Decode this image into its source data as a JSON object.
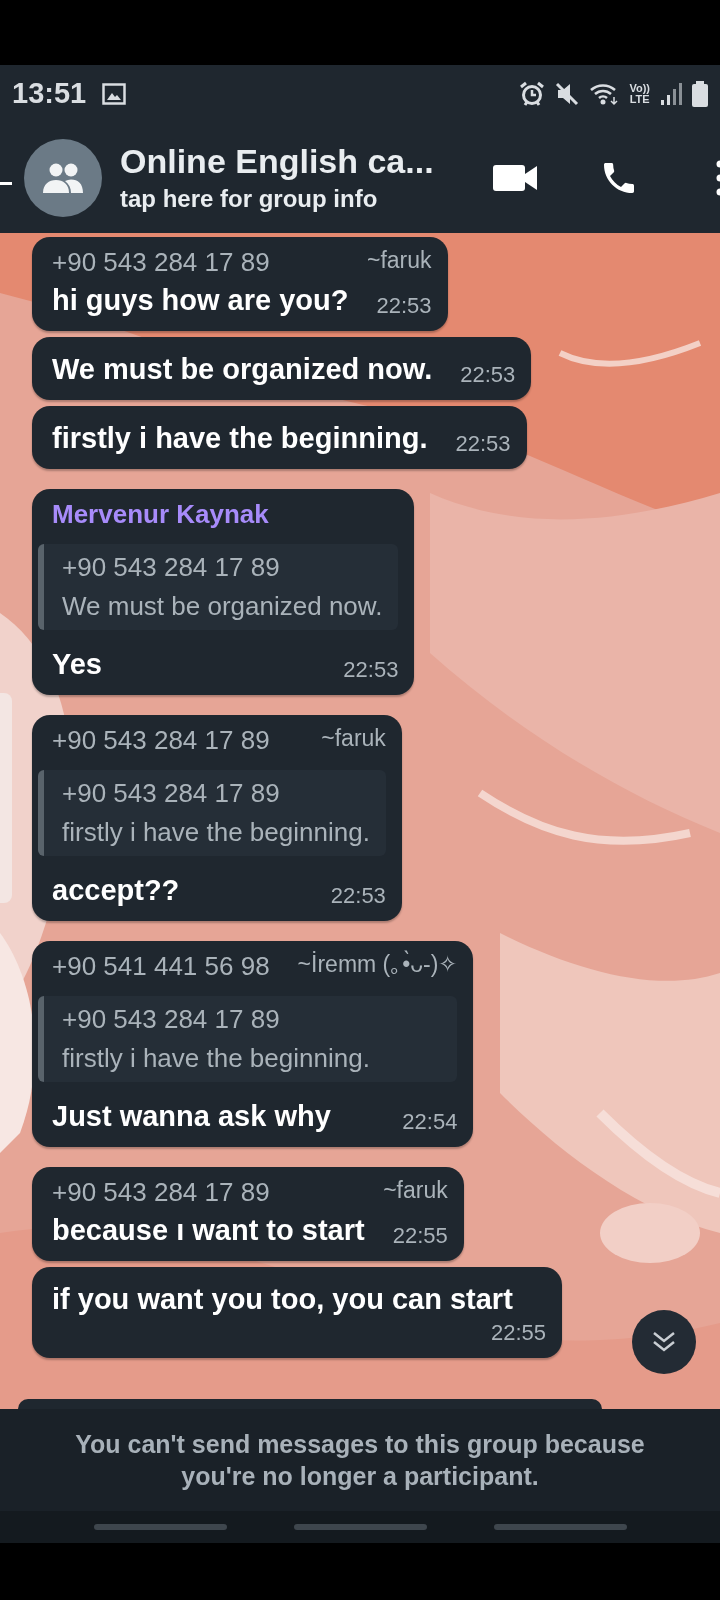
{
  "status_bar": {
    "time": "13:51",
    "network": {
      "top": "Vo))",
      "bottom": "LTE"
    }
  },
  "header": {
    "title": "Online English ca...",
    "subtitle": "tap here for group info"
  },
  "groups": [
    {
      "messages": [
        {
          "sender": {
            "phone": "+90 543 284 17 89",
            "name": "~faruk"
          },
          "text": "hi guys how are you?",
          "time": "22:53"
        },
        {
          "text": "We must be organized now.",
          "time": "22:53"
        },
        {
          "text": "firstly i have the beginning.",
          "time": "22:53"
        }
      ]
    },
    {
      "messages": [
        {
          "sender": {
            "name": "Mervenur Kaynak",
            "color": "#a78bfa"
          },
          "quote": {
            "phone": "+90 543 284 17 89",
            "text": "We must be organized now."
          },
          "text": "Yes",
          "time": "22:53"
        }
      ]
    },
    {
      "messages": [
        {
          "sender": {
            "phone": "+90 543 284 17 89",
            "name": "~faruk"
          },
          "quote": {
            "phone": "+90 543 284 17 89",
            "text": "firstly i have the beginning."
          },
          "text": "accept??",
          "time": "22:53"
        }
      ]
    },
    {
      "messages": [
        {
          "sender": {
            "phone": "+90 541 441 56 98",
            "name": "~İremm (｡•̀ᴗ-)✧"
          },
          "quote": {
            "phone": "+90 543 284 17 89",
            "text": "firstly i have the beginning."
          },
          "text": "Just wanna ask why",
          "time": "22:54"
        }
      ]
    },
    {
      "messages": [
        {
          "sender": {
            "phone": "+90 543 284 17 89",
            "name": "~faruk"
          },
          "text": "because ı want to start",
          "time": "22:55"
        },
        {
          "text": "if you want you too, you can start",
          "time": "22:55"
        }
      ]
    }
  ],
  "footer": {
    "notice": "You can't send messages to this group because you're no longer a participant."
  }
}
